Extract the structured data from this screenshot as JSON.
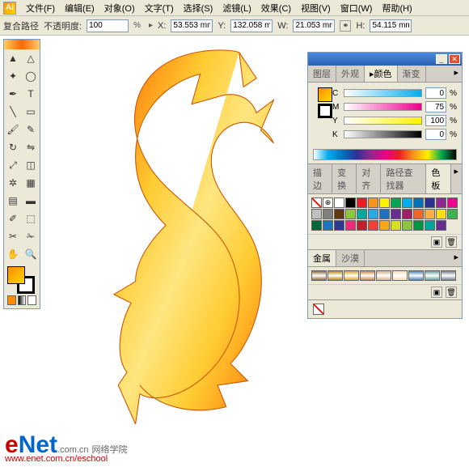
{
  "menu": {
    "items": [
      "文件(F)",
      "编辑(E)",
      "对象(O)",
      "文字(T)",
      "选择(S)",
      "滤镜(L)",
      "效果(C)",
      "视图(V)",
      "窗口(W)",
      "帮助(H)"
    ]
  },
  "options": {
    "pathType": "复合路径",
    "opacityLabel": "不透明度:",
    "opacity": "100",
    "opacityUnit": "%",
    "xLabel": "X:",
    "x": "53.553 mm",
    "yLabel": "Y:",
    "y": "132.058 mm",
    "wLabel": "W:",
    "w": "21.053 mm",
    "hLabel": "H:",
    "h": "54.115 mm"
  },
  "colorPanel": {
    "tabs": [
      "图层",
      "外观",
      "颜色",
      "渐变"
    ],
    "activeTab": 2,
    "channels": [
      {
        "name": "C",
        "value": "0"
      },
      {
        "name": "M",
        "value": "75"
      },
      {
        "name": "Y",
        "value": "100"
      },
      {
        "name": "K",
        "value": "0"
      }
    ],
    "pct": "%"
  },
  "swatchPanel": {
    "tabs": [
      "描边",
      "变换",
      "对齐",
      "路径查找器",
      "色板"
    ],
    "activeTab": 4,
    "colors": [
      "#ffffff",
      "#000000",
      "#ed1c24",
      "#f7941d",
      "#fff200",
      "#00a651",
      "#00aeef",
      "#0072bc",
      "#2e3192",
      "#92278f",
      "#ec008c",
      "#c0c0c0",
      "#808080",
      "#603913",
      "#8dc63f",
      "#00a99d",
      "#27aae1",
      "#1b75bb",
      "#662d91",
      "#9e1f63",
      "#f26522",
      "#fbb040",
      "#ffde17",
      "#39b54a",
      "#006838",
      "#1c75bc",
      "#2b3990",
      "#ee2a7b",
      "#be1e2d",
      "#ef4136",
      "#faa61a",
      "#d7df23",
      "#8cc63f",
      "#009444",
      "#00a79d",
      "#662d91"
    ]
  },
  "metalPanel": {
    "tabs": [
      "金属",
      "沙漠"
    ],
    "activeTab": 0,
    "colors": [
      "#8a6d3b",
      "#b8860b",
      "#daa520",
      "#cd853f",
      "#d2b48c",
      "#f5deb3",
      "#4682b4",
      "#5f9ea0",
      "#708090"
    ]
  },
  "watermark": {
    "e": "e",
    "net": "Net",
    "cn": ".com.cn",
    "sub": "网络学院",
    "url": "www.enet.com.cn/eschool"
  }
}
